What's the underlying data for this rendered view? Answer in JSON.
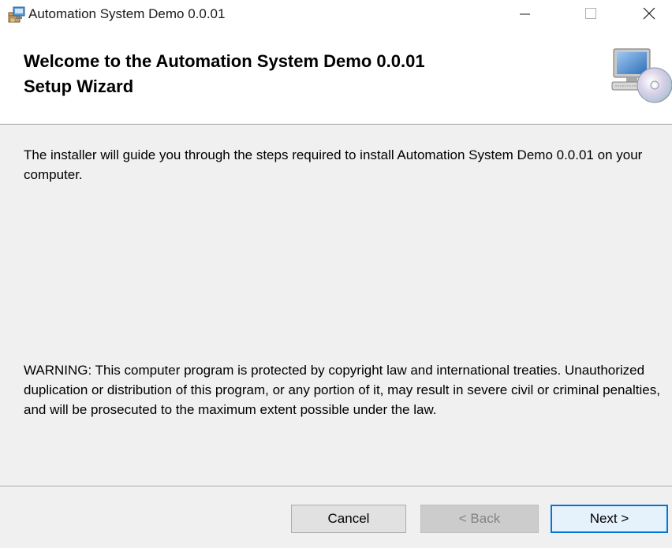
{
  "window": {
    "title": "Automation System Demo 0.0.01",
    "icon": "installer-package-icon"
  },
  "header": {
    "title_line1": "Welcome to the Automation System Demo 0.0.01",
    "title_line2": "Setup Wizard",
    "art": "computer-cd-icon"
  },
  "content": {
    "intro": "The installer will guide you through the steps required to install Automation System Demo 0.0.01 on your computer.",
    "warning": "WARNING: This computer program is protected by copyright law and international treaties. Unauthorized duplication or distribution of this program, or any portion of it, may result in severe civil or criminal penalties, and will be prosecuted to the maximum extent possible under the law."
  },
  "buttons": {
    "cancel": "Cancel",
    "back": "< Back",
    "next": "Next >"
  },
  "colors": {
    "accent": "#0078d7",
    "dialog_bg": "#f0f0f0",
    "header_bg": "#ffffff"
  }
}
